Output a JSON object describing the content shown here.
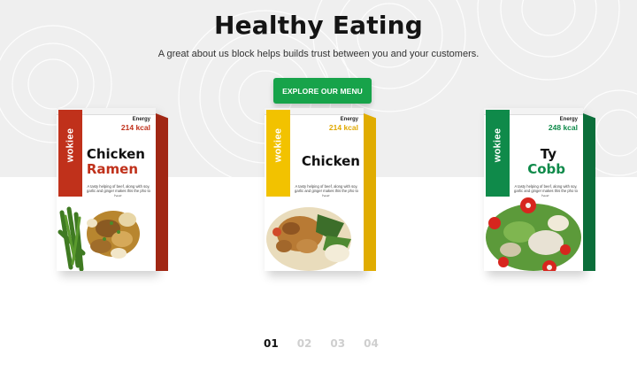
{
  "hero": {
    "title": "Healthy Eating",
    "subtitle": "A great about us block helps builds trust between you and your customers.",
    "cta_label": "EXPLORE OUR MENU"
  },
  "colors": {
    "accent": "#17a34a",
    "red": "#c0311b",
    "yellow": "#f2c200",
    "green": "#0f8a4a"
  },
  "products": [
    {
      "brand": "wokiee",
      "energy_label": "Energy",
      "energy_value": "214 kcal",
      "name_line1": "Chicken",
      "name_line2": "Ramen",
      "description": "A tasty helping of beef, along with soy, garlic and ginger makes this the pho to beat.",
      "color": "#c0311b"
    },
    {
      "brand": "wokiee",
      "energy_label": "Energy",
      "energy_value": "214 kcal",
      "name_line1": "Chicken",
      "name_line2": "",
      "description": "A tasty helping of beef, along with soy, garlic and ginger makes this the pho to beat.",
      "color": "#f2c200"
    },
    {
      "brand": "wokiee",
      "energy_label": "Energy",
      "energy_value": "248 kcal",
      "name_line1": "Ty",
      "name_line2": "Cobb",
      "description": "A tasty helping of beef, along with soy, garlic and ginger makes this the pho to beat.",
      "color": "#0f8a4a"
    }
  ],
  "pagination": [
    "01",
    "02",
    "03",
    "04"
  ],
  "active_page": "01"
}
